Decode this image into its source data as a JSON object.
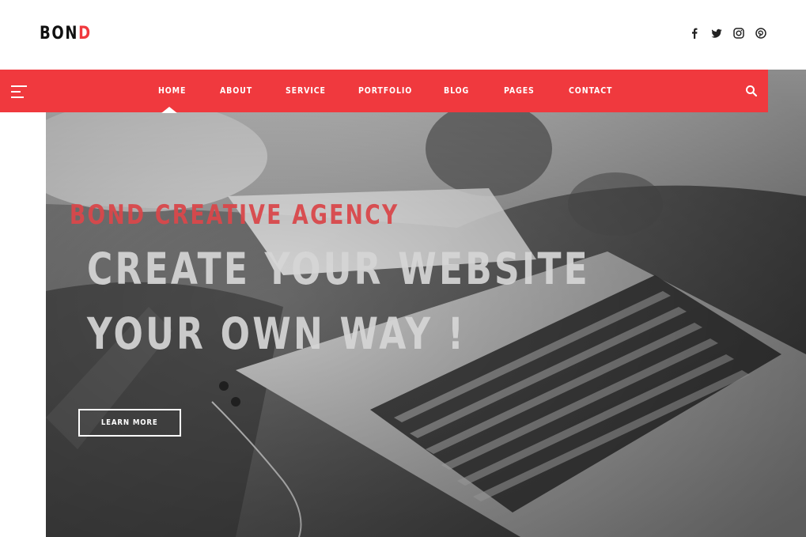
{
  "header": {
    "logo_main": "BON",
    "logo_accent": "D",
    "social": [
      {
        "icon": "facebook-icon"
      },
      {
        "icon": "twitter-icon"
      },
      {
        "icon": "instagram-icon"
      },
      {
        "icon": "pinterest-icon"
      }
    ]
  },
  "nav": {
    "items": [
      "HOME",
      "ABOUT",
      "SERVICE",
      "PORTFOLIO",
      "BLOG",
      "PAGES",
      "CONTACT"
    ],
    "active": "HOME",
    "menu_icon": "hamburger-menu-icon",
    "search_icon": "search-icon"
  },
  "hero": {
    "tagline": "BOND CREATIVE AGENCY",
    "headline_line1": "CREATE YOUR WEBSITE",
    "headline_line2": "YOUR OWN WAY !",
    "cta_label": "LEARN MORE"
  },
  "colors": {
    "accent": "#f0393e",
    "logo_text": "#111111",
    "nav_text": "#ffffff"
  }
}
